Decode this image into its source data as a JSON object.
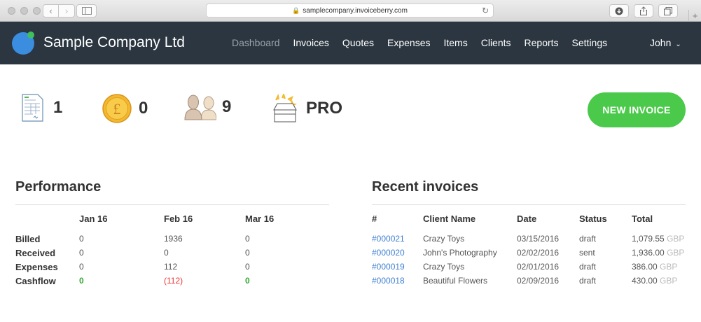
{
  "browser": {
    "url": "samplecompany.invoiceberry.com"
  },
  "header": {
    "company_name": "Sample Company Ltd",
    "nav": [
      {
        "label": "Dashboard",
        "active": true
      },
      {
        "label": "Invoices"
      },
      {
        "label": "Quotes"
      },
      {
        "label": "Expenses"
      },
      {
        "label": "Items"
      },
      {
        "label": "Clients"
      },
      {
        "label": "Reports"
      },
      {
        "label": "Settings"
      }
    ],
    "user_name": "John"
  },
  "stats": {
    "invoices_count": "1",
    "payments_count": "0",
    "clients_count": "9",
    "plan": "PRO"
  },
  "new_invoice_label": "NEW INVOICE",
  "performance": {
    "title": "Performance",
    "months": [
      "Jan 16",
      "Feb 16",
      "Mar 16"
    ],
    "rows": [
      {
        "label": "Billed",
        "values": [
          "0",
          "1936",
          "0"
        ]
      },
      {
        "label": "Received",
        "values": [
          "0",
          "0",
          "0"
        ]
      },
      {
        "label": "Expenses",
        "values": [
          "0",
          "112",
          "0"
        ]
      },
      {
        "label": "Cashflow",
        "values": [
          "0",
          "(112)",
          "0"
        ]
      }
    ]
  },
  "recent_invoices": {
    "title": "Recent invoices",
    "headers": [
      "#",
      "Client Name",
      "Date",
      "Status",
      "Total"
    ],
    "currency": "GBP",
    "rows": [
      {
        "number": "#000021",
        "client": "Crazy Toys",
        "date": "03/15/2016",
        "status": "draft",
        "total": "1,079.55"
      },
      {
        "number": "#000020",
        "client": "John's Photography",
        "date": "02/02/2016",
        "status": "sent",
        "total": "1,936.00"
      },
      {
        "number": "#000019",
        "client": "Crazy Toys",
        "date": "02/01/2016",
        "status": "draft",
        "total": "386.00"
      },
      {
        "number": "#000018",
        "client": "Beautiful Flowers",
        "date": "02/09/2016",
        "status": "draft",
        "total": "430.00"
      }
    ]
  }
}
